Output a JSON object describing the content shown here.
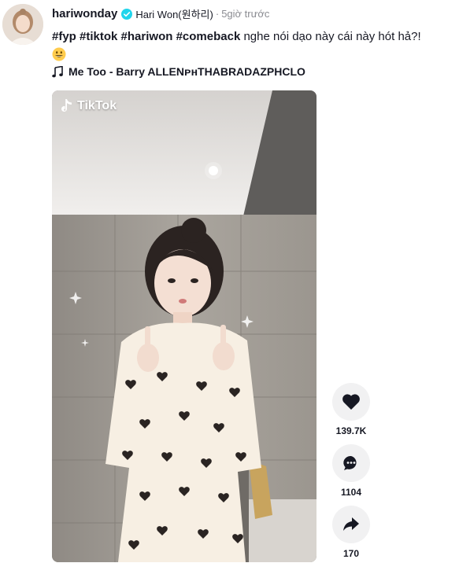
{
  "post": {
    "username": "hariwonday",
    "nickname": "Hari Won(원하리)",
    "separator": "·",
    "time": "5giờ trước",
    "caption": {
      "hashtags": [
        "#fyp",
        "#tiktok",
        "#hariwon",
        "#comeback"
      ],
      "text": "nghe nói dạo này cái này hót hả?!",
      "emoji": "grinning-face-emoji"
    },
    "music": "Me Too - Barry ALLENᴘʜTHABRADAZPHCLO"
  },
  "video": {
    "watermark": "TikTok"
  },
  "actions": {
    "like": {
      "icon": "heart-icon",
      "count": "139.7K"
    },
    "comment": {
      "icon": "comment-icon",
      "count": "1104"
    },
    "share": {
      "icon": "share-icon",
      "count": "170"
    }
  },
  "colors": {
    "text": "#161823",
    "secondary": "#8a8b91",
    "verified": "#20d5ec",
    "action_bg": "#f1f1f2"
  }
}
